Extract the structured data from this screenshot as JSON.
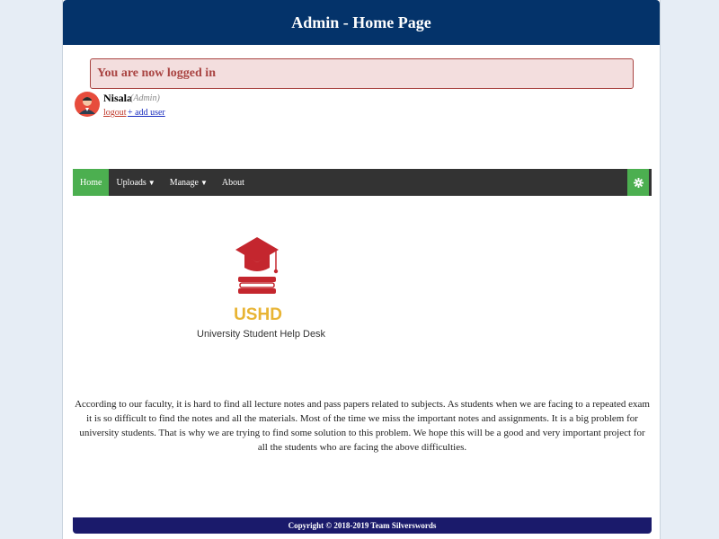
{
  "header": {
    "title": "Admin - Home Page"
  },
  "alert": {
    "message": "You are now logged in"
  },
  "user": {
    "name": "Nisala",
    "role": "(Admin)",
    "logout_label": "logout",
    "add_user_label": "+ add user"
  },
  "nav": {
    "home": "Home",
    "uploads": "Uploads",
    "manage": "Manage",
    "about": "About"
  },
  "logo": {
    "mark": "USHD",
    "caption": "University Student Help Desk"
  },
  "main": {
    "description": "According to our faculty, it is hard to find all lecture notes and pass papers related to subjects. As students when we are facing to a repeated exam it is so difficult to find the notes and all the materials. Most of the time we miss the important notes and assignments. It is a big problem for university students. That is why we are trying to find some solution to this problem. We hope this will be a good and very important project for all the students who are facing the above difficulties."
  },
  "footer": {
    "copyright": "Copyright © 2018-2019 Team Silverswords"
  },
  "colors": {
    "header_bg": "#04336a",
    "alert_bg": "#f3dede",
    "alert_text": "#a94442",
    "nav_bg": "#333333",
    "nav_active": "#4caf50",
    "footer_bg": "#1a1a6b",
    "logo_red": "#c4262e",
    "logo_gold": "#e8b434"
  }
}
